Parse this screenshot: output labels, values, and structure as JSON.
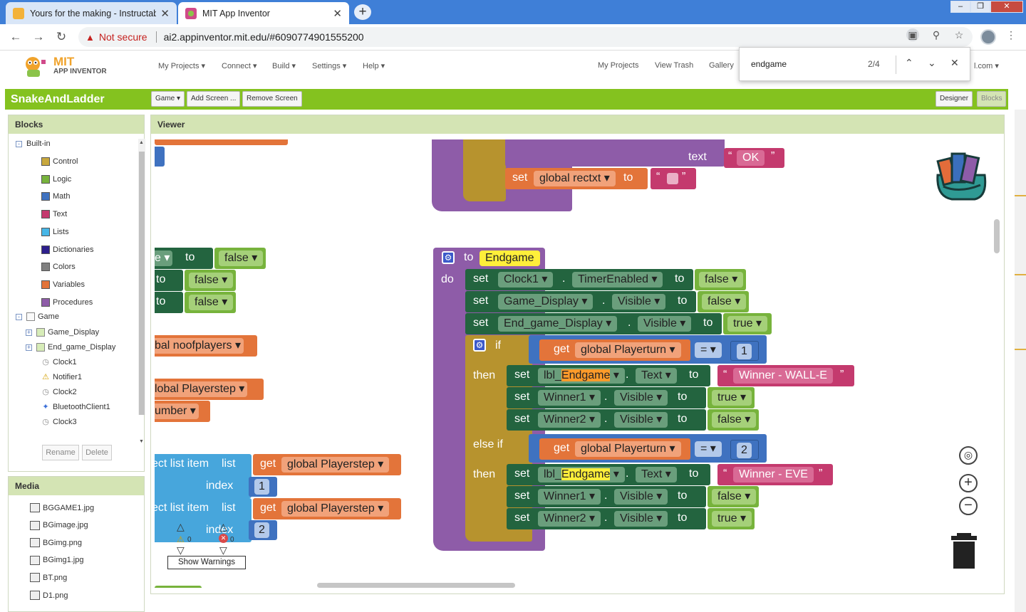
{
  "browser": {
    "tabs": [
      {
        "title": "Yours for the making - Instructab",
        "close": "✕"
      },
      {
        "title": "MIT App Inventor",
        "close": "✕"
      }
    ],
    "new_tab": "+",
    "security": "Not secure",
    "url": "ai2.appinventor.mit.edu/#6090774901555200",
    "window_controls": [
      "–",
      "❐",
      "✕"
    ]
  },
  "app": {
    "logo_mit": "MIT",
    "logo_sub": "APP INVENTOR",
    "menus": [
      "My Projects ▾",
      "Connect ▾",
      "Build ▾",
      "Settings ▾",
      "Help ▾"
    ],
    "right_links": [
      "My Projects",
      "View Trash",
      "Gallery"
    ],
    "account_tail": "l.com ▾",
    "project_name": "SnakeAndLadder",
    "screen_selector": "Game ▾",
    "add_screen": "Add Screen ...",
    "remove_screen": "Remove Screen",
    "designer": "Designer",
    "blocks": "Blocks"
  },
  "find": {
    "query": "endgame",
    "count": "2/4",
    "prev": "⌃",
    "next": "⌄",
    "close": "✕"
  },
  "blocks_panel": {
    "title": "Blocks",
    "builtin_label": "Built-in",
    "builtin": [
      {
        "label": "Control",
        "color": "#c8a83d"
      },
      {
        "label": "Logic",
        "color": "#77b33c"
      },
      {
        "label": "Math",
        "color": "#3f72c0"
      },
      {
        "label": "Text",
        "color": "#c43a6e"
      },
      {
        "label": "Lists",
        "color": "#47b6e7"
      },
      {
        "label": "Dictionaries",
        "color": "#2d1f8c"
      },
      {
        "label": "Colors",
        "color": "#808080"
      },
      {
        "label": "Variables",
        "color": "#e3743a"
      },
      {
        "label": "Procedures",
        "color": "#8e5ca8"
      }
    ],
    "game_label": "Game",
    "components": [
      "Game_Display",
      "End_game_Display",
      "Clock1",
      "Notifier1",
      "Clock2",
      "BluetoothClient1",
      "Clock3"
    ],
    "rename": "Rename",
    "delete": "Delete"
  },
  "media_panel": {
    "title": "Media",
    "files": [
      "BGGAME1.jpg",
      "BGimage.jpg",
      "BGimg.png",
      "BGimg1.jpg",
      "BT.png",
      "D1.png"
    ]
  },
  "viewer": {
    "title": "Viewer",
    "warnings_count": "0",
    "errors_count": "0",
    "show_warnings": "Show Warnings",
    "kw": {
      "text": "text",
      "set": "set",
      "to": "to",
      "do": "do",
      "if": "if",
      "then": "then",
      "else_if": "else if",
      "get": "get",
      "list": "list",
      "index": "index",
      "dot": "."
    },
    "top_block": {
      "ok": "OK",
      "rectxt": "global rectxt ▾",
      "quote_l": "“",
      "quote_r": "”"
    },
    "left_fragments": {
      "false": "false ▾",
      "e_to": "e ▾",
      "noofplayers": "bal noofplayers ▾",
      "playerstep": "lobal Playerstep ▾",
      "number": "umber ▾",
      "select_list_item": "ect list item",
      "gp_step": "global Playerstep ▾",
      "one": "1",
      "two": "2"
    },
    "procedure": {
      "name": "Endgame",
      "rows": [
        {
          "comp": "Clock1 ▾",
          "prop": "TimerEnabled ▾",
          "value": "false ▾"
        },
        {
          "comp": "Game_Display ▾",
          "prop": "Visible ▾",
          "value": "false ▾"
        },
        {
          "comp": "End_game_Display ▾",
          "prop": "Visible ▾",
          "value": "true ▾"
        }
      ],
      "cond_var": "global Playerturn ▾",
      "eq": "= ▾",
      "cond1": "1",
      "cond2": "2",
      "label_prefix": "lbl_",
      "label_suffix": " ▾",
      "text_prop": "Text ▾",
      "winner_wall": "Winner - WALL-E",
      "winner_eve": "Winner - EVE",
      "winner1": "Winner1 ▾",
      "winner2": "Winner2 ▾",
      "visible": "Visible ▾",
      "true": "true ▾",
      "false": "false ▾"
    }
  },
  "colors": {
    "green_bar": "#84c21f",
    "proc": "#8e5ca8",
    "control": "#b7932e",
    "comp_set": "#23643f",
    "logic": "#77b33c",
    "text": "#c43a6e",
    "var": "#e3743a",
    "math": "#3f72c0",
    "list": "#47a6dc"
  }
}
